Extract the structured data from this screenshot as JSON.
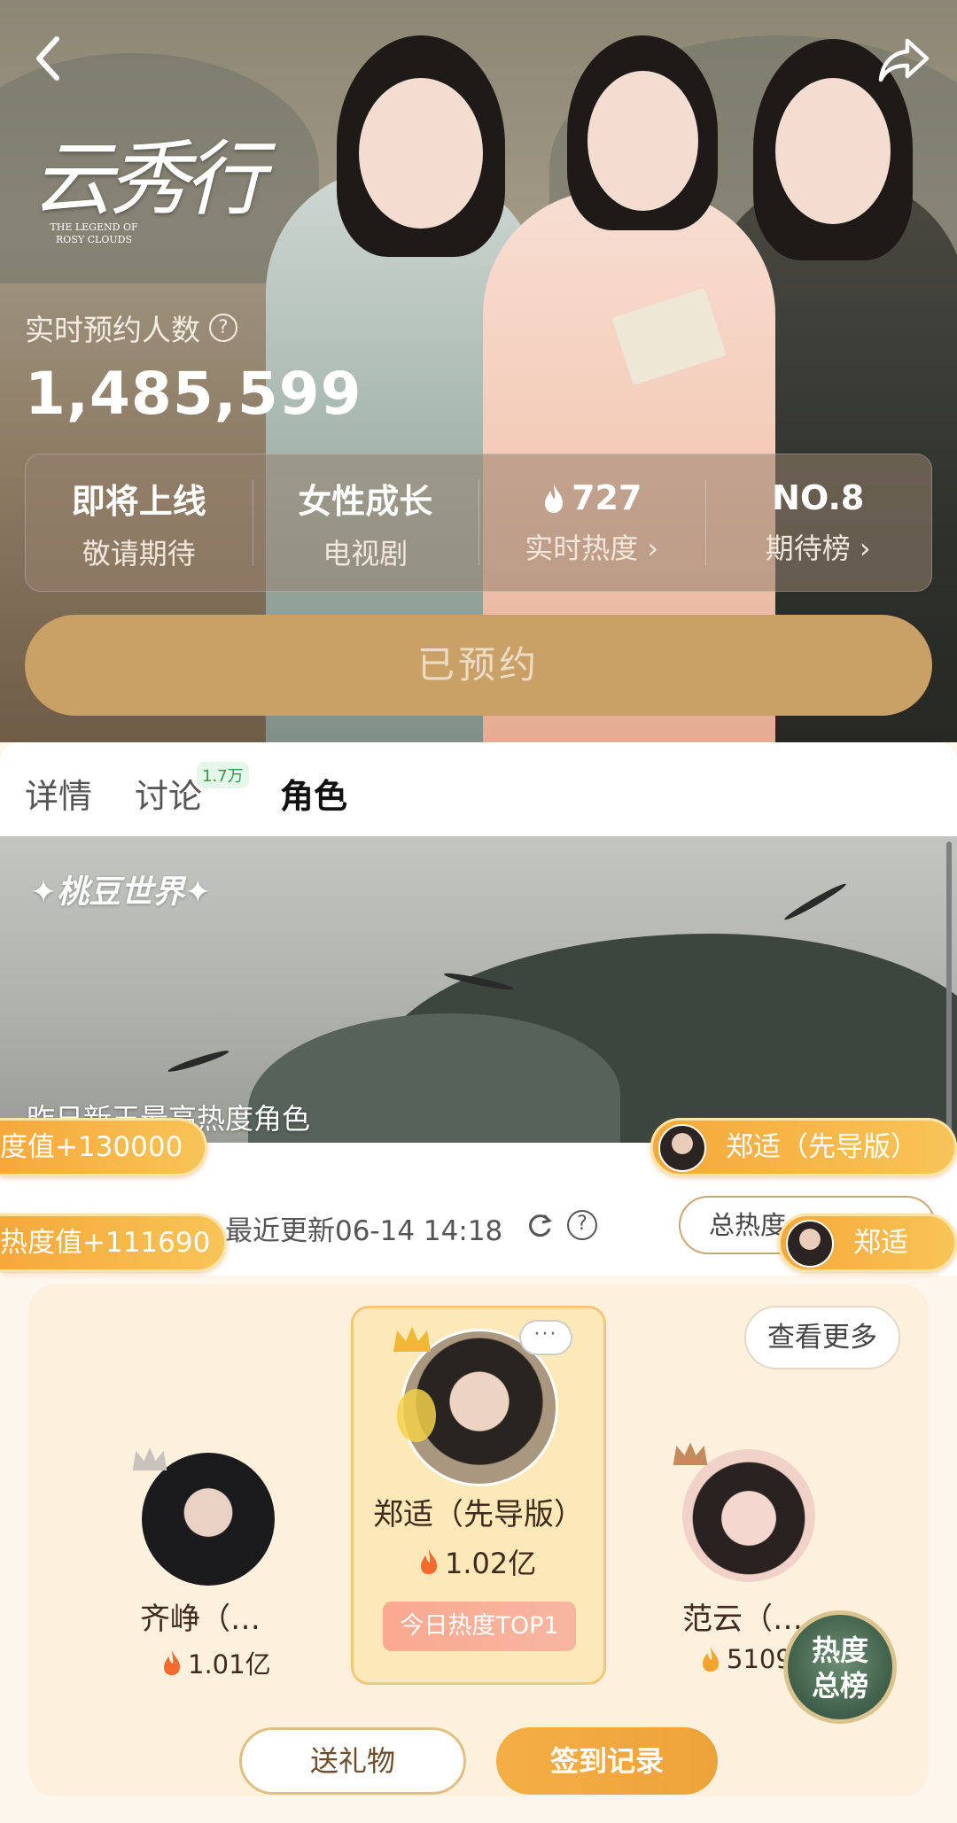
{
  "header": {
    "logo_cn": "云秀行",
    "logo_en": "THE LEGEND OF ROSY CLOUDS"
  },
  "reservation": {
    "label": "实时预约人数",
    "count": "1,485,599"
  },
  "info_bar": [
    {
      "top": "即将上线",
      "sub": "敬请期待"
    },
    {
      "top": "女性成长",
      "sub": "电视剧"
    },
    {
      "top": "727",
      "sub": "实时热度 ›"
    },
    {
      "top": "NO.8",
      "sub": "期待榜 ›"
    }
  ],
  "reserved_button": "已预约",
  "tabs": [
    {
      "label": "详情"
    },
    {
      "label": "讨论",
      "badge": "1.7万"
    },
    {
      "label": "角色",
      "active": true
    }
  ],
  "banner": {
    "logo": "✦桃豆世界✦",
    "caption": "昨日新王最高热度角色"
  },
  "update": {
    "text": "最近更新06-14 14:18",
    "total_button": "总热度"
  },
  "bullets": [
    {
      "text": "度值+130000"
    },
    {
      "text": "热度值+111690"
    },
    {
      "text": "郑适（先导版）"
    },
    {
      "text": "郑适"
    }
  ],
  "ranking": {
    "more_button": "查看更多",
    "chat_icon": "···",
    "first": {
      "name": "郑适（先导版）",
      "heat": "1.02亿",
      "tag": "今日热度TOP1"
    },
    "second": {
      "name": "齐峥（…",
      "heat": "1.01亿"
    },
    "third": {
      "name": "范云（…",
      "heat": "5109"
    },
    "badge": "热度总榜",
    "badge_line1": "热度",
    "badge_line2": "总榜"
  },
  "actions": {
    "gift": "送礼物",
    "checkin": "签到记录"
  },
  "colors": {
    "accent_gold": "#c9a066",
    "bullet_orange": "#f6a83a",
    "checkin_orange": "#f4ae45",
    "tab_badge_green": "#2c9c4c"
  }
}
